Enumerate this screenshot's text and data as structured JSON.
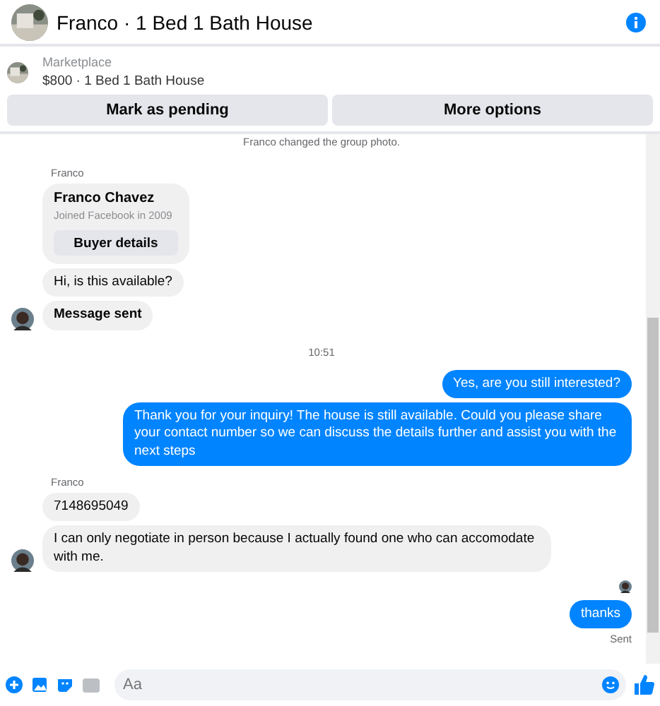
{
  "header": {
    "title": "Franco · 1 Bed 1 Bath House"
  },
  "listing": {
    "source": "Marketplace",
    "summary": "$800 · 1 Bed 1 Bath House",
    "buttons": [
      "Mark as pending",
      "More options"
    ]
  },
  "messages": [
    {
      "kind": "system",
      "text": "Franco changed the group photo."
    },
    {
      "kind": "sender",
      "text": "Franco"
    },
    {
      "kind": "card",
      "name": "Franco Chavez",
      "detail": "Joined Facebook in 2009",
      "button": "Buyer details"
    },
    {
      "kind": "incoming",
      "text": "Hi, is this available?",
      "avatar": false
    },
    {
      "kind": "incoming",
      "text": "Message sent",
      "avatar": true,
      "bold": true
    },
    {
      "kind": "time",
      "text": "10:51"
    },
    {
      "kind": "outgoing",
      "text": "Yes, are you still interested?"
    },
    {
      "kind": "outgoing",
      "text": "Thank you for your inquiry! The house is still available. Could you please share your contact number so we can discuss the details further and assist you with the next steps"
    },
    {
      "kind": "sender",
      "text": "Franco"
    },
    {
      "kind": "incoming",
      "text": "7148695049",
      "avatar": false
    },
    {
      "kind": "incoming",
      "text": "I can only negotiate in person because I actually found one who can accomodate with me.",
      "avatar": true
    },
    {
      "kind": "seen"
    },
    {
      "kind": "outgoing",
      "text": "thanks"
    },
    {
      "kind": "status",
      "text": "Sent"
    }
  ],
  "composer": {
    "placeholder": "Aa"
  }
}
